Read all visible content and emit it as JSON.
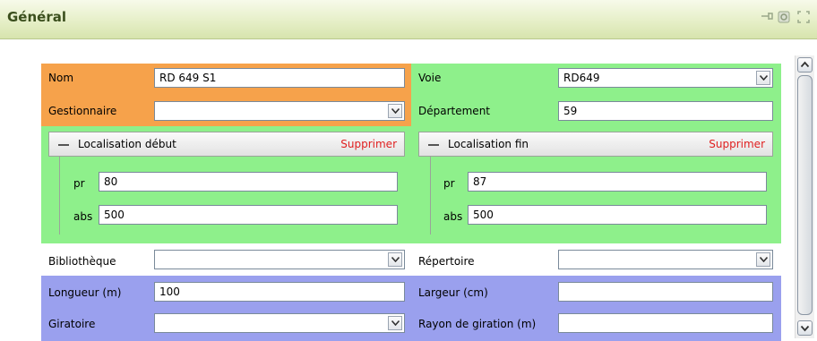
{
  "header": {
    "title": "Général"
  },
  "toolbar_icons": [
    "pin-icon",
    "settings-icon",
    "maximize-icon"
  ],
  "left": {
    "nom": {
      "label": "Nom",
      "value": "RD 649 S1"
    },
    "gestionnaire": {
      "label": "Gestionnaire",
      "value": ""
    },
    "loc_debut": {
      "title": "Localisation début",
      "delete": "Supprimer",
      "pr": {
        "label": "pr",
        "value": "80"
      },
      "abs": {
        "label": "abs",
        "value": "500"
      }
    },
    "bibliotheque": {
      "label": "Bibliothèque",
      "value": ""
    },
    "longueur": {
      "label": "Longueur (m)",
      "value": "100"
    },
    "giratoire": {
      "label": "Giratoire",
      "value": ""
    }
  },
  "right": {
    "voie": {
      "label": "Voie",
      "value": "RD649"
    },
    "departement": {
      "label": "Département",
      "value": "59"
    },
    "loc_fin": {
      "title": "Localisation fin",
      "delete": "Supprimer",
      "pr": {
        "label": "pr",
        "value": "87"
      },
      "abs": {
        "label": "abs",
        "value": "500"
      }
    },
    "repertoire": {
      "label": "Répertoire",
      "value": ""
    },
    "largeur": {
      "label": "Largeur (cm)",
      "value": ""
    },
    "rayon": {
      "label": "Rayon de giration (m)",
      "value": ""
    }
  },
  "colors": {
    "orange": "#f6a24b",
    "green": "#8ef08b",
    "blue": "#9aa0ee",
    "delete": "#e02020"
  }
}
